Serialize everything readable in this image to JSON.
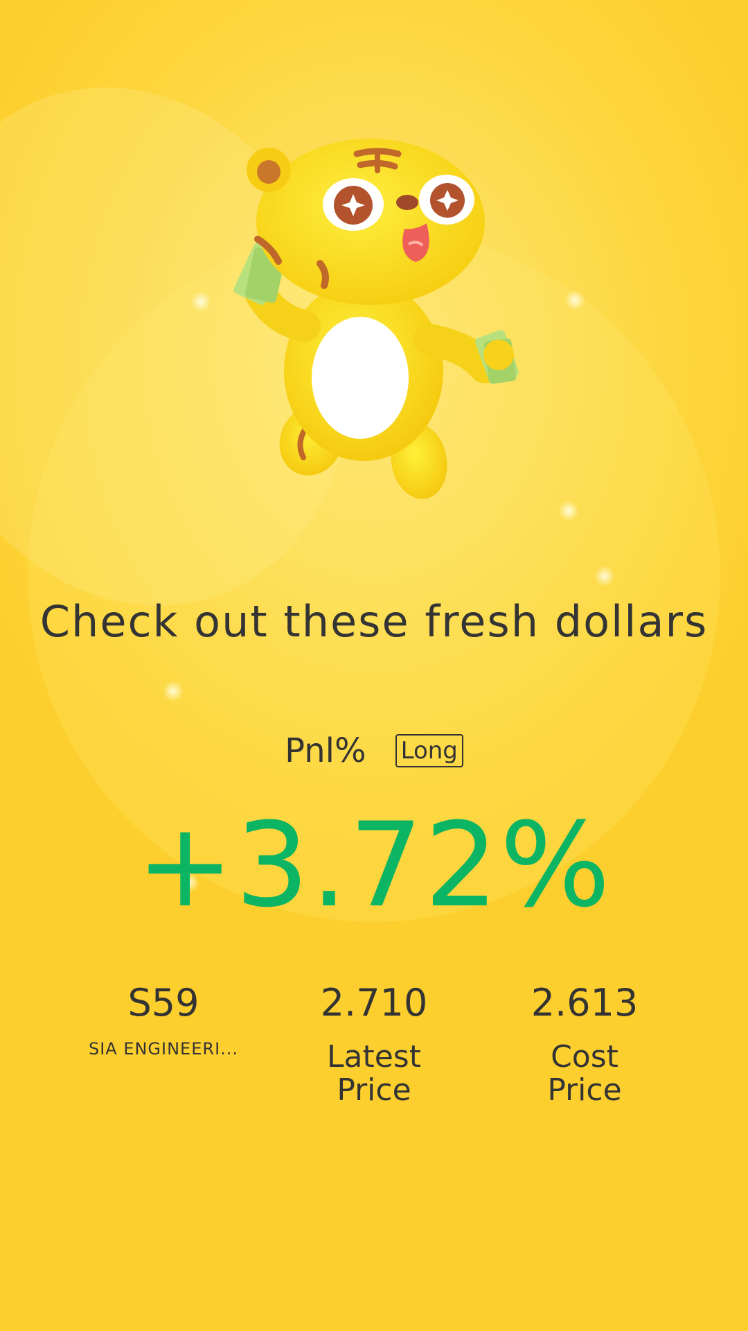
{
  "headline": "Check out these fresh dollars",
  "pnl": {
    "label": "Pnl%",
    "badge": "Long",
    "value": "+3.72%"
  },
  "stats": {
    "symbol": {
      "value": "S59",
      "sub": "SIA ENGINEERI..."
    },
    "latest_price": {
      "value": "2.710",
      "label": "Latest Price"
    },
    "cost_price": {
      "value": "2.613",
      "label": "Cost Price"
    }
  },
  "colors": {
    "background": "#fdd53a",
    "accent_positive": "#0cb563",
    "text": "#333333"
  },
  "icons": {
    "mascot": "tiger-mascot-holding-money-icon"
  }
}
